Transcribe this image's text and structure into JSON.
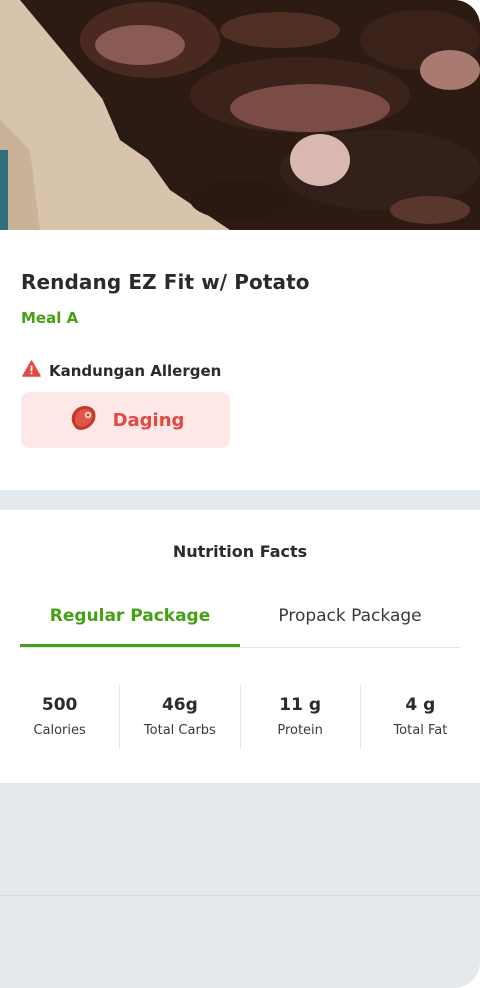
{
  "meal": {
    "name": "Rendang EZ Fit w/ Potato",
    "category": "Meal A"
  },
  "allergen": {
    "heading": "Kandungan Allergen",
    "items": [
      {
        "label": "Daging",
        "icon": "meat-icon"
      }
    ]
  },
  "nutrition": {
    "title": "Nutrition Facts",
    "tabs": [
      {
        "label": "Regular Package",
        "active": true
      },
      {
        "label": "Propack Package",
        "active": false
      }
    ],
    "stats": [
      {
        "value": "500",
        "label": "Calories"
      },
      {
        "value": "46g",
        "label": "Total Carbs"
      },
      {
        "value": "11 g",
        "label": "Protein"
      },
      {
        "value": "4 g",
        "label": "Total Fat"
      }
    ]
  },
  "colors": {
    "accent_green": "#45a016",
    "allergen_red": "#e04a43",
    "allergen_bg": "#fde7e7"
  }
}
